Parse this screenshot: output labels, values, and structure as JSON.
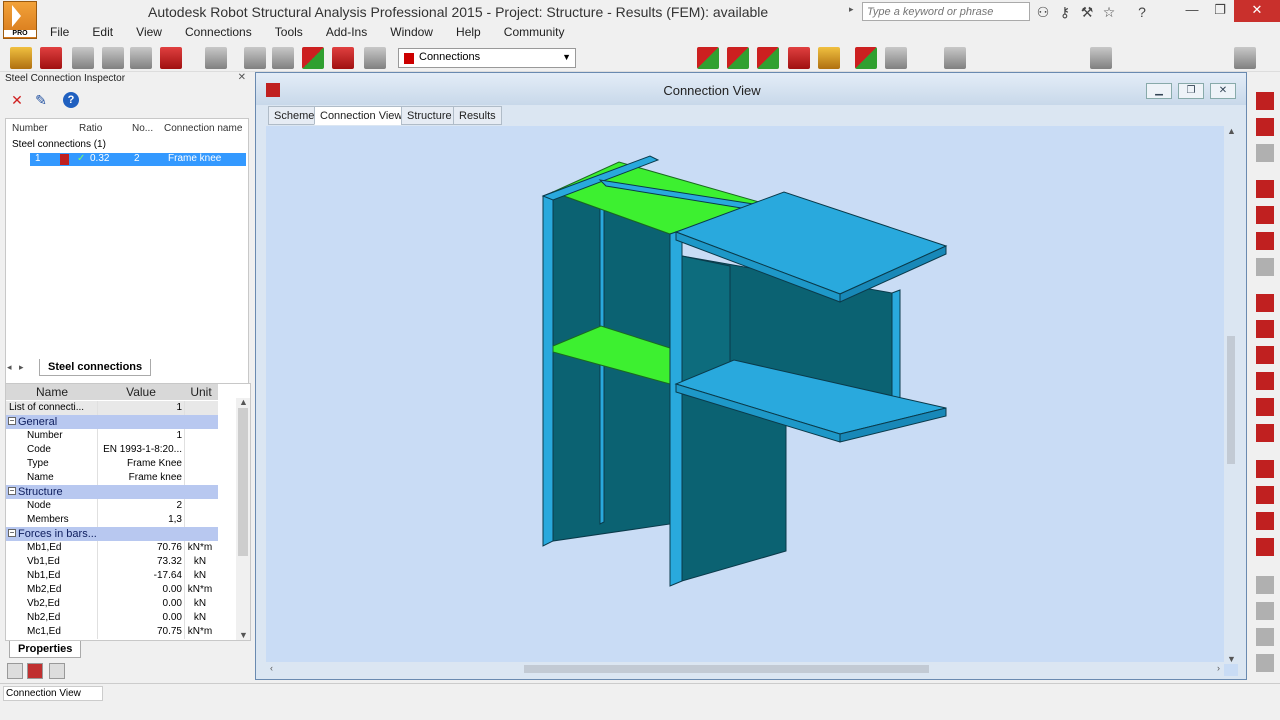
{
  "window": {
    "title": "Autodesk Robot Structural Analysis Professional 2015 - Project: Structure - Results (FEM): available",
    "search_placeholder": "Type a keyword or phrase",
    "logo_text": "PRO"
  },
  "menu": [
    "File",
    "Edit",
    "View",
    "Connections",
    "Tools",
    "Add-Ins",
    "Window",
    "Help",
    "Community"
  ],
  "toolbar": {
    "layout_combo": "Connections"
  },
  "inspector": {
    "title": "Steel Connection Inspector",
    "list_headers": {
      "number": "Number",
      "ratio": "Ratio",
      "no": "No...",
      "name": "Connection name"
    },
    "group_label": "Steel connections (1)",
    "row": {
      "number": "1",
      "ratio": "0.32",
      "node": "2",
      "name": "Frame knee"
    },
    "tab_label": "Steel connections"
  },
  "properties": {
    "headers": {
      "name": "Name",
      "value": "Value",
      "unit": "Unit"
    },
    "rows": [
      {
        "kind": "top",
        "name": "List of connecti...",
        "value": "1",
        "unit": ""
      },
      {
        "kind": "group",
        "name": "General"
      },
      {
        "kind": "item",
        "name": "Number",
        "value": "1",
        "unit": ""
      },
      {
        "kind": "item",
        "name": "Code",
        "value": "EN 1993-1-8:20...",
        "unit": ""
      },
      {
        "kind": "item",
        "name": "Type",
        "value": "Frame Knee",
        "unit": ""
      },
      {
        "kind": "item",
        "name": "Name",
        "value": "Frame knee",
        "unit": ""
      },
      {
        "kind": "group",
        "name": "Structure"
      },
      {
        "kind": "item",
        "name": "Node",
        "value": "2",
        "unit": ""
      },
      {
        "kind": "item",
        "name": "Members",
        "value": "1,3",
        "unit": ""
      },
      {
        "kind": "group",
        "name": "Forces in bars..."
      },
      {
        "kind": "item",
        "name": "Mb1,Ed",
        "value": "70.76",
        "unit": "kN*m"
      },
      {
        "kind": "item",
        "name": "Vb1,Ed",
        "value": "73.32",
        "unit": "kN"
      },
      {
        "kind": "item",
        "name": "Nb1,Ed",
        "value": "-17.64",
        "unit": "kN"
      },
      {
        "kind": "item",
        "name": "Mb2,Ed",
        "value": "0.00",
        "unit": "kN*m"
      },
      {
        "kind": "item",
        "name": "Vb2,Ed",
        "value": "0.00",
        "unit": "kN"
      },
      {
        "kind": "item",
        "name": "Nb2,Ed",
        "value": "0.00",
        "unit": "kN"
      },
      {
        "kind": "item",
        "name": "Mc1,Ed",
        "value": "70.75",
        "unit": "kN*m"
      }
    ],
    "tab_label": "Properties"
  },
  "connection_view": {
    "title": "Connection View",
    "tabs": [
      "Scheme",
      "Connection View",
      "Structure",
      "Results"
    ],
    "active_tab": "Connection View",
    "colors": {
      "steel": "#29a9dd",
      "steel_dark": "#0a5e6e",
      "stiffener": "#3df030",
      "background": "#c9dcf5"
    }
  },
  "status": {
    "text": "Connection View"
  }
}
